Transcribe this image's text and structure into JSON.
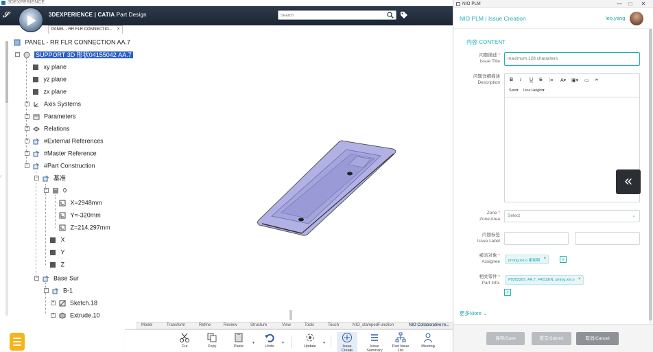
{
  "catia": {
    "window_title": "3DEXPERIENCE",
    "brand": "3DEXPERIENCE | CATIA",
    "app": "Part Design",
    "search_placeholder": "Search",
    "doc_tab": "PANEL - RR FLR CONNECTIO...",
    "tree": {
      "root": "PANEL - RR FLR CONNECTION AA.7",
      "items": [
        "SUPPORT 3D 形状04155042 AA.7",
        "xy plane",
        "yz plane",
        "zx plane",
        "Axis Systems",
        "Parameters",
        "Relations",
        "External References",
        "Master Reference",
        "Part Construction",
        "基准",
        "0",
        "X=2948mm",
        "Y=-320mm",
        "Z=214.297mm",
        "X",
        "Y",
        "Z",
        "Base Sur",
        "B-1",
        "Sketch.18",
        "Extrude.10"
      ]
    },
    "section_tabs": [
      "Model",
      "Transform",
      "Refine",
      "Review",
      "Structure",
      "View",
      "Tools",
      "Touch",
      "NIO_stampedFunction",
      "NIO Collaborative re..."
    ],
    "actions": [
      {
        "label": "Cut"
      },
      {
        "label": "Copy"
      },
      {
        "label": "Paste"
      },
      {
        "label": "Undo"
      },
      {
        "label": "Update"
      },
      {
        "label": "Issue Create"
      },
      {
        "label": "Issue Summary"
      },
      {
        "label": "Part Issue List"
      },
      {
        "label": "Meeting"
      }
    ]
  },
  "plm": {
    "window_title": "NIO PLM",
    "brand": "NIO PLM | Issue Creation",
    "user": "leo.yang",
    "section_title": "内容 CONTENT",
    "fields": {
      "issue_title": {
        "label_cn": "问题描述",
        "label_en": "Issue Title",
        "placeholder": "maximum 128 characters"
      },
      "description": {
        "label_cn": "问题详细描述",
        "label_en": "Description"
      },
      "zone": {
        "label_cn": "Zone",
        "label_en": "Zone Area",
        "placeholder": "Select"
      },
      "issue_label": {
        "label_cn": "问题标签",
        "label_en": "Issue Label"
      },
      "assignee": {
        "label_cn": "被派对象",
        "label_en": "Assignee",
        "chip": "pming.xie.o 谢宪明"
      },
      "part_info": {
        "label_cn": "相关零件",
        "label_en": "Part Info.",
        "chip": "P0202287, AA.7, FROZEN, pming.xie.o"
      }
    },
    "editor_toolbar": {
      "bold": "B",
      "italic": "I",
      "underline": "U",
      "strike": "S",
      "size": "Size",
      "line_height": "Line Height"
    },
    "more": "更多More",
    "buttons": {
      "save": "保存/Save",
      "submit": "提交/Submit",
      "cancel": "取消/Cancel"
    },
    "colors": {
      "accent": "#20b0b4",
      "disabled_btn": "#b9bcc0",
      "cancel_btn": "#8e9196"
    }
  }
}
